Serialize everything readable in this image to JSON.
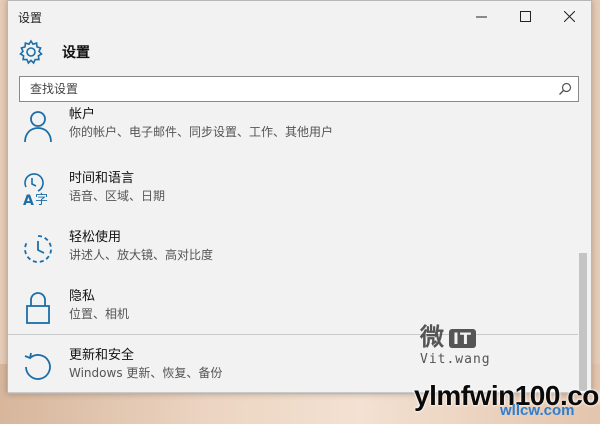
{
  "window": {
    "title": "设置",
    "min_glyph": "—",
    "max_glyph": "☐",
    "close_glyph": "✕"
  },
  "header": {
    "title": "设置",
    "icon": "gear-icon"
  },
  "search": {
    "placeholder": "查找设置",
    "value": "",
    "icon": "search-icon"
  },
  "items": [
    {
      "label": "帐户",
      "desc": "你的帐户、电子邮件、同步设置、工作、其他用户",
      "icon": "person-icon"
    },
    {
      "label": "时间和语言",
      "desc": "语音、区域、日期",
      "icon": "time-language-icon"
    },
    {
      "label": "轻松使用",
      "desc": "讲述人、放大镜、高对比度",
      "icon": "ease-of-access-icon"
    },
    {
      "label": "隐私",
      "desc": "位置、相机",
      "icon": "lock-icon"
    },
    {
      "label": "更新和安全",
      "desc": "Windows 更新、恢复、备份",
      "icon": "update-icon"
    }
  ],
  "watermark": {
    "top": "微",
    "badge": "IT",
    "bottom": "Vit.wang"
  },
  "site": {
    "main": "ylmfwin100.com",
    "sub": "wllcw.com"
  },
  "colors": {
    "accent": "#1b6ea8",
    "window_bg": "#f2f2f2"
  }
}
